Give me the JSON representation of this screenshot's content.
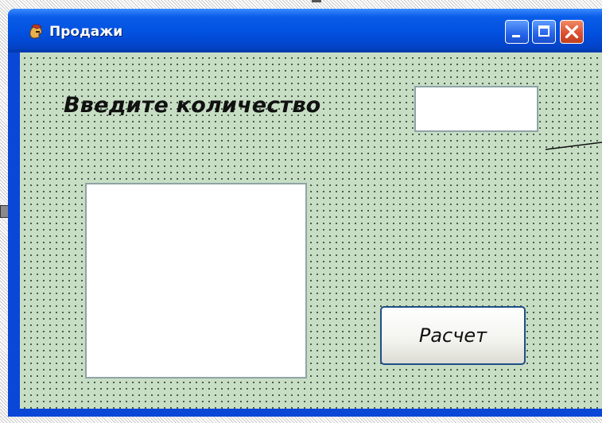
{
  "window": {
    "title": "Продажи",
    "controls": {
      "minimize": "minimize",
      "maximize": "maximize",
      "close": "close"
    },
    "icons": {
      "app": "trojan-helmet-icon",
      "minimize": "minimize-icon",
      "maximize": "maximize-icon",
      "close": "close-icon"
    }
  },
  "form": {
    "prompt_label": "Введите количество",
    "quantity_input": {
      "value": "",
      "placeholder": ""
    },
    "result_box": {
      "value": ""
    },
    "calc_button_label": "Расчет"
  },
  "colors": {
    "title_bar": "#0250e0",
    "client_bg": "#c7dec5",
    "close_button": "#dd5131",
    "button_border": "#1f4f86"
  }
}
